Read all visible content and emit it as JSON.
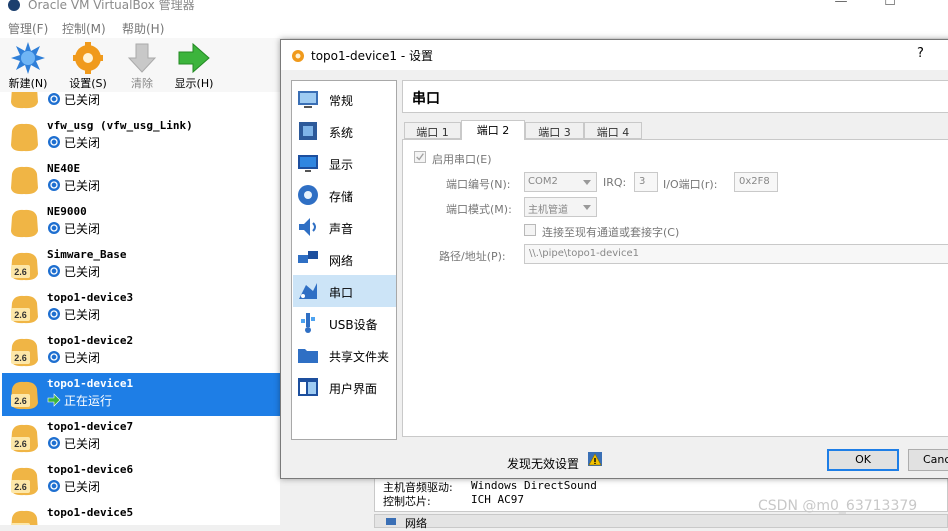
{
  "main_window": {
    "title": "Oracle VM VirtualBox 管理器",
    "controls": {
      "minimize": "—",
      "maximize": "☐"
    }
  },
  "menu": [
    {
      "label": "管理(F)"
    },
    {
      "label": "控制(M)"
    },
    {
      "label": "帮助(H)"
    }
  ],
  "toolbar": {
    "new_label": "新建(N)",
    "settings_label": "设置(S)",
    "discard_label": "清除",
    "show_label": "显示(H)"
  },
  "vm_list": {
    "partial_top_status": "已关闭",
    "items": [
      {
        "name": "vfw_usg (vfw_usg_Link)",
        "status": "已关闭",
        "badge": "",
        "selected": false
      },
      {
        "name": "NE40E",
        "status": "已关闭",
        "badge": "",
        "selected": false
      },
      {
        "name": "NE9000",
        "status": "已关闭",
        "badge": "",
        "selected": false
      },
      {
        "name": "Simware_Base",
        "status": "已关闭",
        "badge": "2.6",
        "selected": false
      },
      {
        "name": "topo1-device3",
        "status": "已关闭",
        "badge": "2.6",
        "selected": false
      },
      {
        "name": "topo1-device2",
        "status": "已关闭",
        "badge": "2.6",
        "selected": false
      },
      {
        "name": "topo1-device1",
        "status": "正在运行",
        "badge": "2.6",
        "selected": true
      },
      {
        "name": "topo1-device7",
        "status": "已关闭",
        "badge": "2.6",
        "selected": false
      },
      {
        "name": "topo1-device6",
        "status": "已关闭",
        "badge": "2.6",
        "selected": false
      },
      {
        "name": "topo1-device5",
        "status": "",
        "badge": "2.6",
        "selected": false
      }
    ]
  },
  "details_peek": {
    "audio_driver_label": "主机音频驱动:",
    "audio_driver_value": "Windows DirectSound",
    "controller_label": "控制芯片:",
    "controller_value": "ICH AC97",
    "next_section": "网络"
  },
  "dialog": {
    "title": "topo1-device1 - 设置",
    "help": "?",
    "sidebar": [
      {
        "label": "常规",
        "icon": "general-icon"
      },
      {
        "label": "系统",
        "icon": "system-icon"
      },
      {
        "label": "显示",
        "icon": "display-icon"
      },
      {
        "label": "存储",
        "icon": "storage-icon"
      },
      {
        "label": "声音",
        "icon": "audio-icon"
      },
      {
        "label": "网络",
        "icon": "network-icon"
      },
      {
        "label": "串口",
        "icon": "serial-port-icon"
      },
      {
        "label": "USB设备",
        "icon": "usb-icon"
      },
      {
        "label": "共享文件夹",
        "icon": "shared-folder-icon"
      },
      {
        "label": "用户界面",
        "icon": "user-interface-icon"
      }
    ],
    "active_page": "串口",
    "tabs": [
      {
        "label": "端口 1"
      },
      {
        "label": "端口 2"
      },
      {
        "label": "端口 3"
      },
      {
        "label": "端口 4"
      }
    ],
    "form": {
      "enable_label": "启用串口(E)",
      "enable_checked": true,
      "port_number_label": "端口编号(N):",
      "port_number_value": "COM2",
      "irq_label": "IRQ:",
      "irq_value": "3",
      "io_port_label": "I/O端口(r):",
      "io_port_value": "0x2F8",
      "port_mode_label": "端口模式(M):",
      "port_mode_value": "主机管道",
      "connect_existing_label": "连接至现有通道或套接字(C)",
      "connect_existing_checked": false,
      "path_label": "路径/地址(P):",
      "path_value": "\\\\.\\pipe\\topo1-device1"
    },
    "footer": {
      "warning": "发现无效设置",
      "ok": "OK",
      "cancel": "Cancel"
    }
  },
  "watermark": "CSDN @m0_63713379",
  "colors": {
    "selection": "#1e7ee6",
    "sidebar_active": "#cce4f7",
    "os_icon": "#f0b545"
  }
}
